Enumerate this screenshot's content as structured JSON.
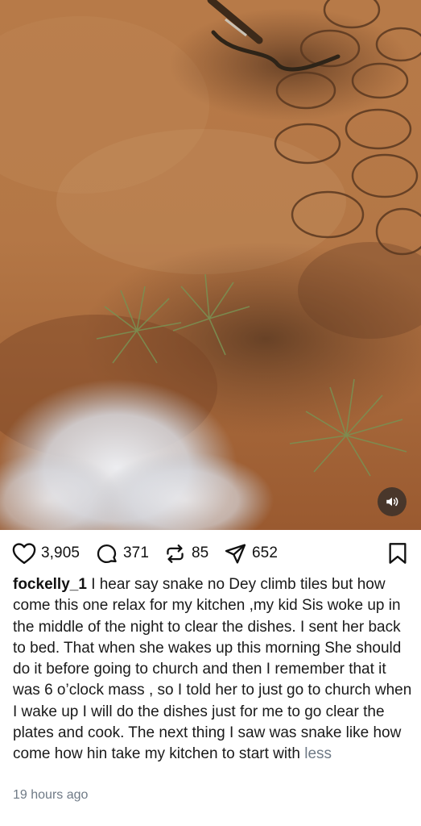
{
  "post": {
    "likes": "3,905",
    "comments": "371",
    "reposts": "85",
    "shares": "652",
    "username": "fockelly_1",
    "caption": "I hear say snake no Dey climb tiles but how come this one relax for my kitchen ,my kid Sis woke up in the middle of the night to clear the dishes. I sent her back to bed. That when she wakes up this morning She should do it before going to church and then I remember that it was 6 o’clock mass , so I told her to just go to church when I wake up I will do the dishes just for me to go clear the plates and cook. The next thing I saw was snake like how come how hin take my kitchen to start with",
    "less_label": "less",
    "timestamp": "19 hours ago"
  },
  "icons": {
    "like": "heart-icon",
    "comment": "comment-bubble-icon",
    "repost": "repost-arrows-icon",
    "share": "send-icon",
    "bookmark": "bookmark-icon",
    "mute": "speaker-icon"
  }
}
